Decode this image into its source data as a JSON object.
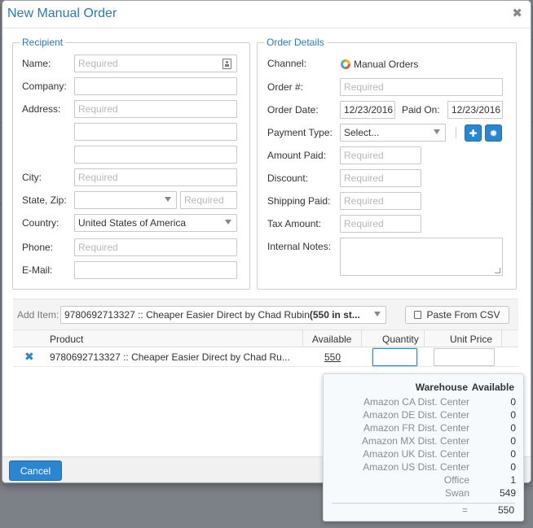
{
  "dialog": {
    "title": "New Manual Order"
  },
  "recipient": {
    "legend": "Recipient",
    "name": {
      "label": "Name:",
      "placeholder": "Required"
    },
    "company": {
      "label": "Company:"
    },
    "address": {
      "label": "Address:",
      "placeholder": "Required"
    },
    "city": {
      "label": "City:",
      "placeholder": "Required"
    },
    "state_zip": {
      "label": "State, Zip:",
      "zip_placeholder": "Required"
    },
    "country": {
      "label": "Country:",
      "value": "United States of America"
    },
    "phone": {
      "label": "Phone:",
      "placeholder": "Required"
    },
    "email": {
      "label": "E-Mail:"
    }
  },
  "order": {
    "legend": "Order Details",
    "channel": {
      "label": "Channel:",
      "value": "Manual Orders"
    },
    "order_no": {
      "label": "Order #:",
      "placeholder": "Required"
    },
    "order_date": {
      "label": "Order Date:",
      "value": "12/23/2016"
    },
    "paid_on": {
      "label": "Paid On:",
      "value": "12/23/2016"
    },
    "payment_type": {
      "label": "Payment Type:",
      "value": "Select..."
    },
    "amount_paid": {
      "label": "Amount Paid:",
      "placeholder": "Required"
    },
    "discount": {
      "label": "Discount:",
      "placeholder": "Required"
    },
    "shipping_paid": {
      "label": "Shipping Paid:",
      "placeholder": "Required"
    },
    "tax_amount": {
      "label": "Tax Amount:",
      "placeholder": "Required"
    },
    "internal_notes": {
      "label": "Internal Notes:"
    }
  },
  "add_item": {
    "label": "Add Item:",
    "value_prefix": "9780692713327 :: Cheaper Easier Direct by Chad Rubin ",
    "value_stock": "(550 in st...",
    "paste_button": "Paste From CSV"
  },
  "table": {
    "headers": {
      "product": "Product",
      "available": "Available",
      "quantity": "Quantity",
      "unit_price": "Unit Price"
    },
    "row": {
      "product": "9780692713327 :: Cheaper Easier Direct by Chad Ru...",
      "available": "550"
    }
  },
  "availability": {
    "header_warehouse": "Warehouse",
    "header_available": "Available",
    "rows": [
      {
        "name": "Amazon CA Dist. Center",
        "value": "0"
      },
      {
        "name": "Amazon DE Dist. Center",
        "value": "0"
      },
      {
        "name": "Amazon FR Dist. Center",
        "value": "0"
      },
      {
        "name": "Amazon MX Dist. Center",
        "value": "0"
      },
      {
        "name": "Amazon UK Dist. Center",
        "value": "0"
      },
      {
        "name": "Amazon US Dist. Center",
        "value": "0"
      },
      {
        "name": "Office",
        "value": "1"
      },
      {
        "name": "Swan",
        "value": "549"
      }
    ],
    "total_label": "=",
    "total_value": "550"
  },
  "footer": {
    "cancel": "Cancel"
  },
  "colors": {
    "accent": "#2a86d1",
    "title": "#2a7ab8"
  }
}
